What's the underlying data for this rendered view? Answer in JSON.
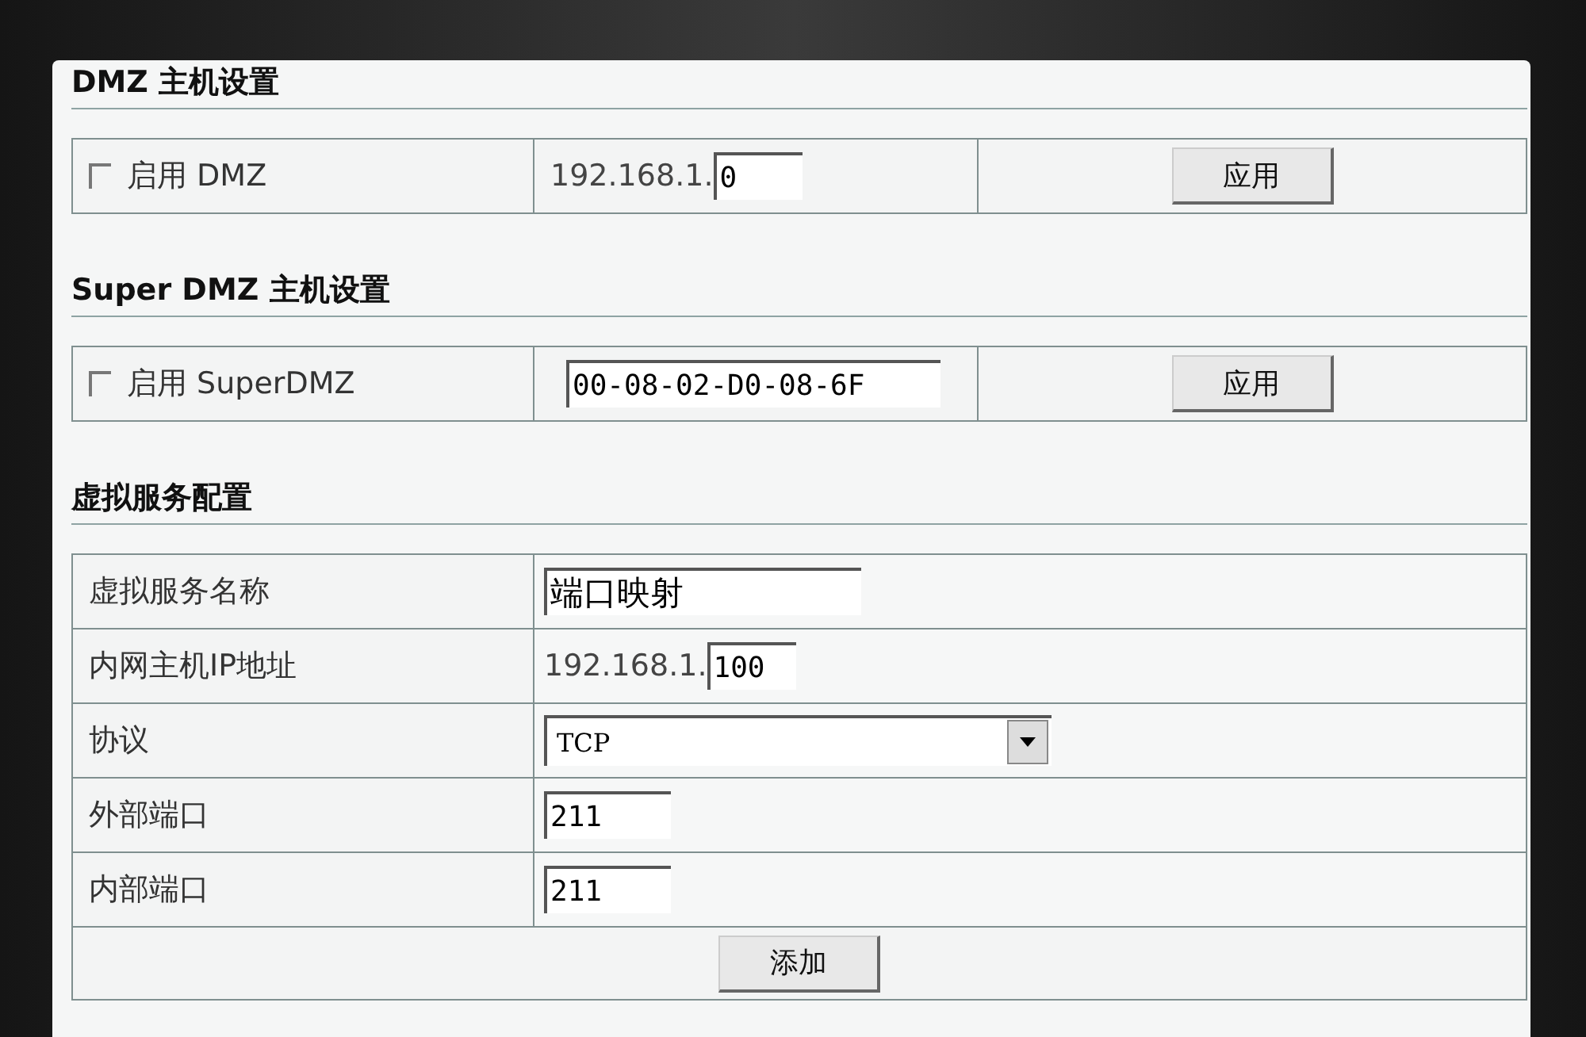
{
  "sections": [
    {
      "title": "DMZ 主机设置",
      "enable": {
        "label": "启用 DMZ",
        "checked": false
      },
      "address": {
        "kind": "ip",
        "prefix": "192.168.1.",
        "value": "0"
      },
      "button": "应用"
    },
    {
      "title": "Super DMZ 主机设置",
      "enable": {
        "label": "启用 SuperDMZ",
        "checked": false
      },
      "address": {
        "kind": "text",
        "value": "00-08-02-D0-08-6F"
      },
      "button": "应用"
    }
  ],
  "virtual_service": {
    "title": "虚拟服务配置",
    "rows": [
      {
        "label": "虚拟服务名称",
        "kind": "text",
        "value": "端口映射"
      },
      {
        "label": "内网主机IP地址",
        "kind": "ip",
        "prefix": "192.168.1.",
        "value": "100"
      },
      {
        "label": "协议",
        "kind": "select",
        "value": "TCP"
      },
      {
        "label": "外部端口",
        "kind": "short",
        "value": "211"
      },
      {
        "label": "内部端口",
        "kind": "short",
        "value": "211"
      }
    ],
    "button": "添加"
  }
}
